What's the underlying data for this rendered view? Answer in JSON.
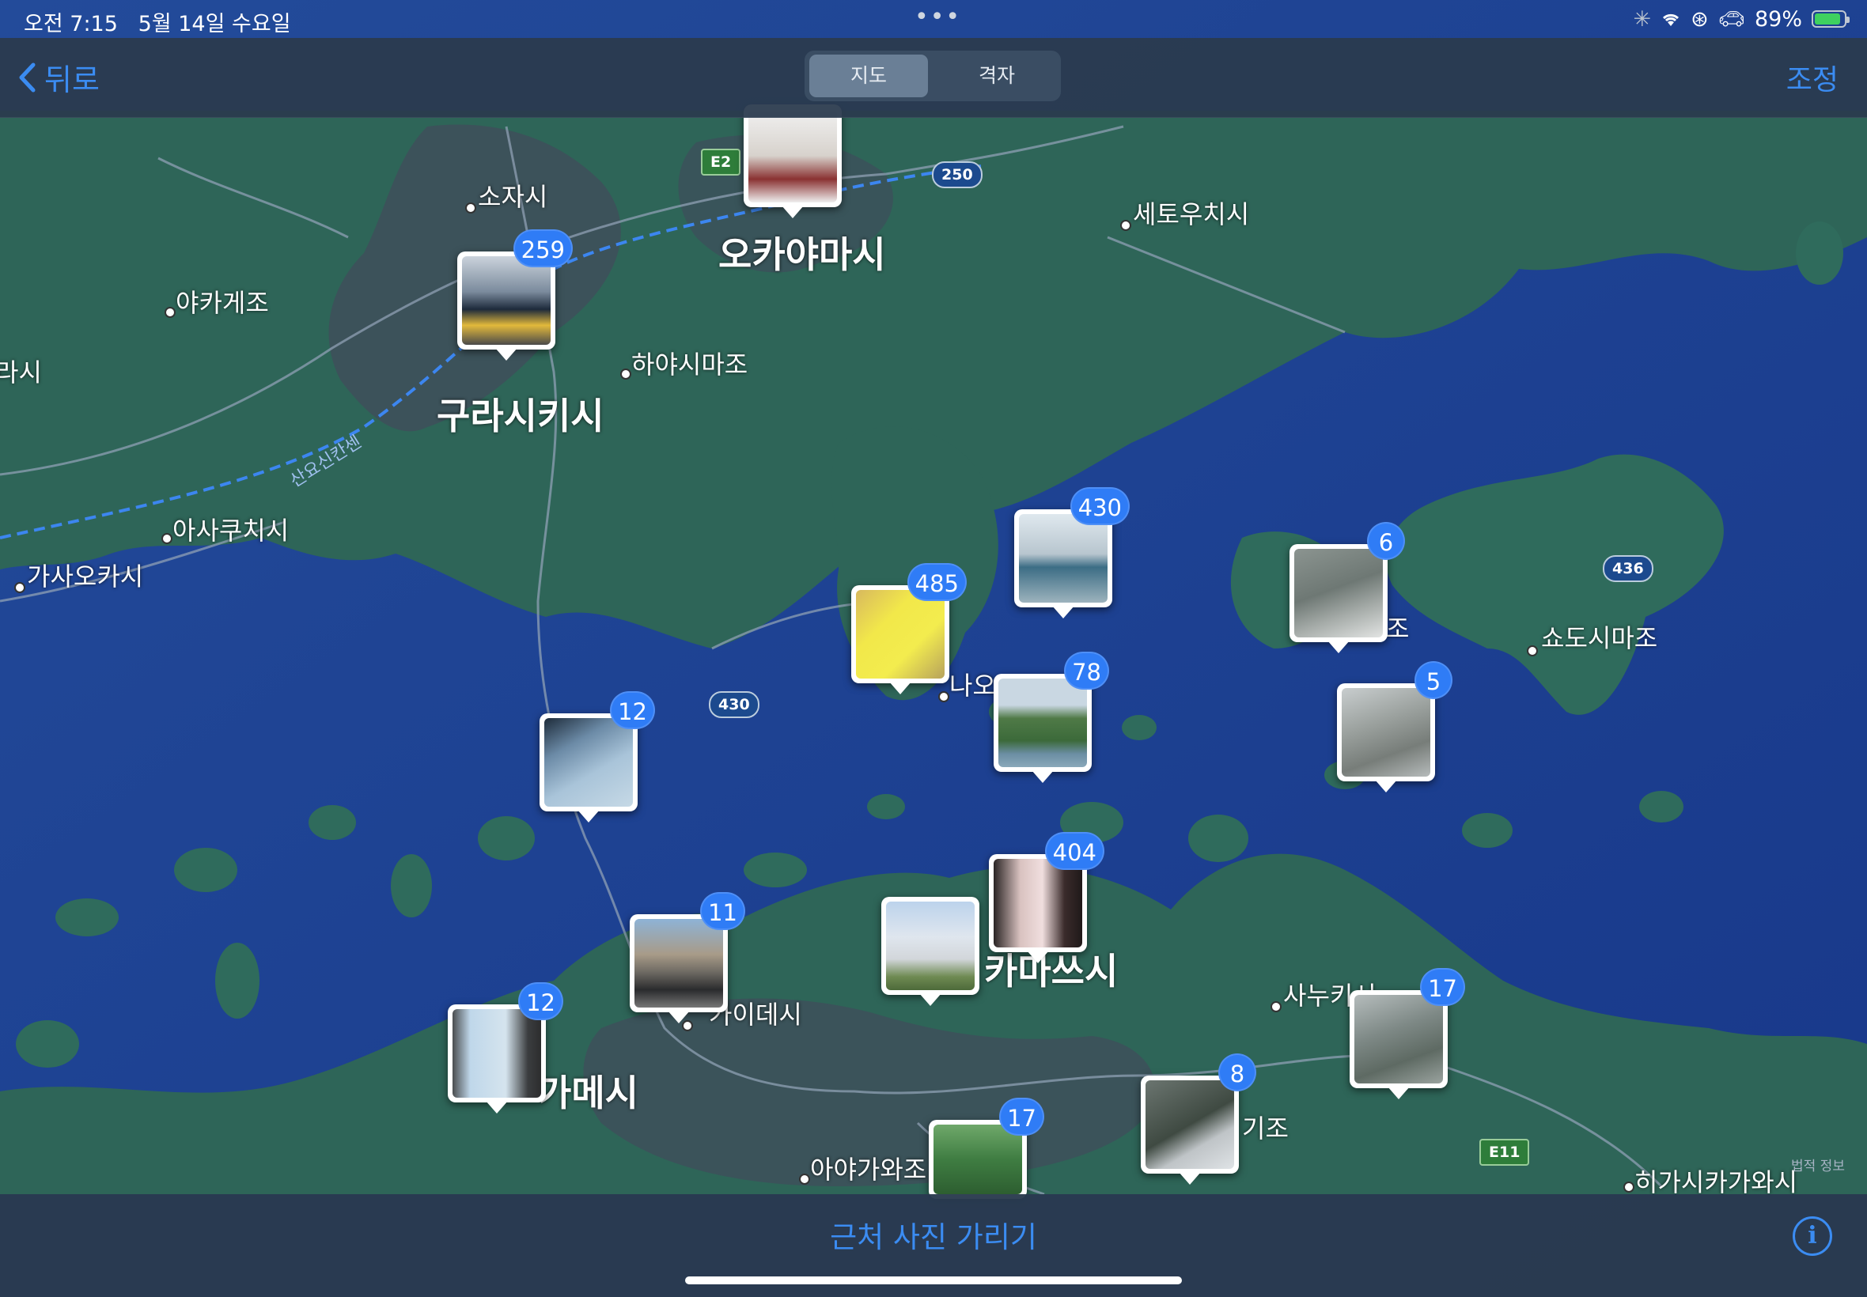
{
  "status": {
    "time": "오전 7:15",
    "date": "5월 14일 수요일",
    "battery_text": "89%",
    "battery_level": 0.89
  },
  "nav": {
    "back_label": "뒤로",
    "segments": [
      "지도",
      "격자"
    ],
    "selected_segment": "지도",
    "adjust_label": "조정"
  },
  "map": {
    "cities": [
      "소자시",
      "오카야마시",
      "세토우치시",
      "야카게조",
      "하야시마조",
      "구라시키시",
      "아사쿠치시",
      "가사오카시",
      "쇼도시마조",
      "나오",
      "가이데시",
      "가메시",
      "카마쓰시",
      "사누키시",
      "아야가와조",
      "히가시카가와시",
      "라시",
      "조",
      "기조"
    ],
    "road_shields": [
      "E2",
      "250",
      "430",
      "436",
      "E11"
    ],
    "route_label": "산요신칸센",
    "legal_label": "법적 정보",
    "photo_pins": [
      {
        "count": "259"
      },
      {
        "count": "485"
      },
      {
        "count": "430"
      },
      {
        "count": "78"
      },
      {
        "count": "6"
      },
      {
        "count": "5"
      },
      {
        "count": "12"
      },
      {
        "count": "404"
      },
      {
        "count": "11"
      },
      {
        "count": "12"
      },
      {
        "count": "17"
      },
      {
        "count": "8"
      },
      {
        "count": "17"
      },
      {
        "count": ""
      }
    ]
  },
  "bottom": {
    "hide_nearby_label": "근처 사진 가리기",
    "info_label": "i"
  },
  "colors": {
    "accent": "#3b8cf2",
    "badge": "#2f7cf6",
    "sea": "#1e3f92",
    "land": "#2f6b5c"
  }
}
